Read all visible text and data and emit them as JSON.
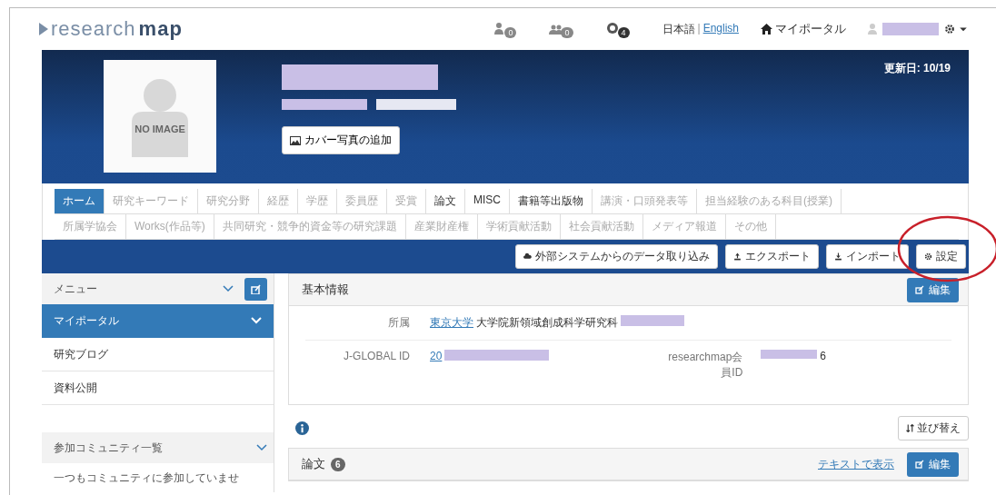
{
  "header": {
    "logo": {
      "prefix": "research",
      "suffix": "map"
    },
    "notifications": [
      {
        "kind": "person",
        "count": "0"
      },
      {
        "kind": "group",
        "count": "0"
      },
      {
        "kind": "chat",
        "count": "4"
      }
    ],
    "languages": [
      {
        "label": "日本語",
        "selected": true
      },
      {
        "label": "English",
        "selected": false
      }
    ],
    "language_separator": "|",
    "portal_link": "マイポータル"
  },
  "profile": {
    "photo_label": "NO IMAGE",
    "cover_button": "カバー写真の追加",
    "updated": "更新日: 10/19"
  },
  "tabs": [
    [
      {
        "label": "ホーム",
        "selected": true,
        "disabled": false
      },
      {
        "label": "研究キーワード",
        "selected": false,
        "disabled": true
      },
      {
        "label": "研究分野",
        "selected": false,
        "disabled": true
      },
      {
        "label": "経歴",
        "selected": false,
        "disabled": true
      },
      {
        "label": "学歴",
        "selected": false,
        "disabled": true
      },
      {
        "label": "委員歴",
        "selected": false,
        "disabled": true
      },
      {
        "label": "受賞",
        "selected": false,
        "disabled": true
      },
      {
        "label": "論文",
        "selected": false,
        "disabled": false
      },
      {
        "label": "MISC",
        "selected": false,
        "disabled": false
      },
      {
        "label": "書籍等出版物",
        "selected": false,
        "disabled": false
      },
      {
        "label": "講演・口頭発表等",
        "selected": false,
        "disabled": true
      },
      {
        "label": "担当経験のある科目(授業)",
        "selected": false,
        "disabled": true
      }
    ],
    [
      {
        "label": "所属学協会",
        "selected": false,
        "disabled": true
      },
      {
        "label": "Works(作品等)",
        "selected": false,
        "disabled": true
      },
      {
        "label": "共同研究・競争的資金等の研究課題",
        "selected": false,
        "disabled": true
      },
      {
        "label": "産業財産権",
        "selected": false,
        "disabled": true
      },
      {
        "label": "学術貢献活動",
        "selected": false,
        "disabled": true
      },
      {
        "label": "社会貢献活動",
        "selected": false,
        "disabled": true
      },
      {
        "label": "メディア報道",
        "selected": false,
        "disabled": true
      },
      {
        "label": "その他",
        "selected": false,
        "disabled": true
      }
    ]
  ],
  "actions": [
    {
      "kind": "cloud",
      "label": "外部システムからのデータ取り込み"
    },
    {
      "kind": "export",
      "label": "エクスポート"
    },
    {
      "kind": "import",
      "label": "インポート"
    },
    {
      "kind": "gear",
      "label": "設定"
    }
  ],
  "sidebar": {
    "menu_title": "メニュー",
    "items": [
      {
        "label": "マイポータル",
        "selected": true
      },
      {
        "label": "研究ブログ",
        "selected": false
      },
      {
        "label": "資料公開",
        "selected": false
      }
    ],
    "community_title": "参加コミュニティ一覧",
    "community_text": "一つもコミュニティに参加していませ"
  },
  "basic_info": {
    "title": "基本情報",
    "edit": "編集",
    "affiliation_label": "所属",
    "affiliation_link": "東京大学",
    "affiliation_text": "大学院新領域創成科学研究科",
    "jglobal_label": "J-GLOBAL ID",
    "jglobal_value": "20",
    "member_label": "researchmap会員ID",
    "member_value": "6"
  },
  "sort_button": "並び替え",
  "papers": {
    "title": "論文",
    "count": "6",
    "text_link": "テキストで表示",
    "edit": "編集"
  }
}
